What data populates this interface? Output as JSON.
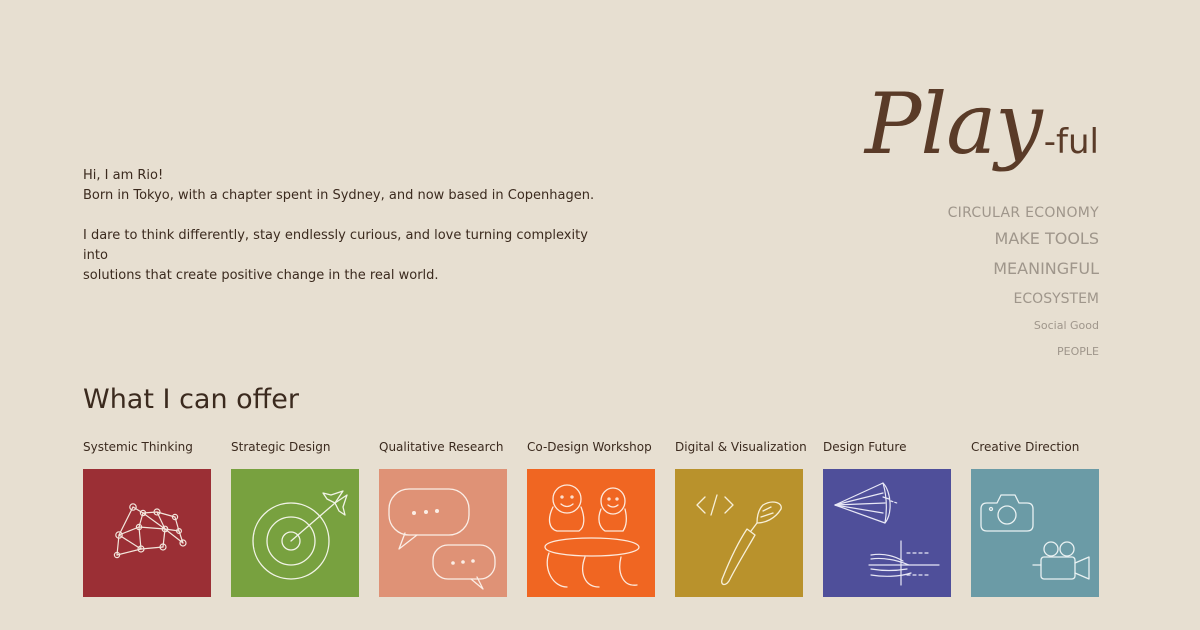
{
  "intro": {
    "line1": "Hi, I am Rio!",
    "line2": "Born in Tokyo, with a chapter spent in Sydney, and now based in Copenhagen.",
    "line3": "I dare to think differently, stay endlessly curious, and love turning complexity into",
    "line4": "solutions that create positive change in the real world."
  },
  "brand": {
    "play": "Play",
    "suffix": "-ful"
  },
  "keywords": [
    "CIRCULAR ECONOMY",
    "MAKE TOOLS",
    "MEANINGFUL",
    "ECOSYSTEM",
    "Social Good",
    "PEOPLE"
  ],
  "offer": {
    "title": "What I can offer",
    "items": [
      {
        "label": "Systemic Thinking",
        "color": "#9b2f35",
        "icon": "network-icon"
      },
      {
        "label": "Strategic Design",
        "color": "#78a13f",
        "icon": "target-icon"
      },
      {
        "label": "Qualitative Research",
        "color": "#df9276",
        "icon": "speech-bubbles-icon"
      },
      {
        "label": "Co-Design Workshop",
        "color": "#f06622",
        "icon": "people-table-icon"
      },
      {
        "label": "Digital & Visualization",
        "color": "#b9922c",
        "icon": "code-brush-icon"
      },
      {
        "label": "Design Future",
        "color": "#4f4f9a",
        "icon": "futures-cone-icon"
      },
      {
        "label": "Creative Direction",
        "color": "#6b9ba6",
        "icon": "camera-icon"
      }
    ]
  },
  "colors": {
    "background": "#e7dfd1",
    "text": "#3b2a1e",
    "brand": "#5a3b28",
    "keywords": "#9f968b"
  }
}
